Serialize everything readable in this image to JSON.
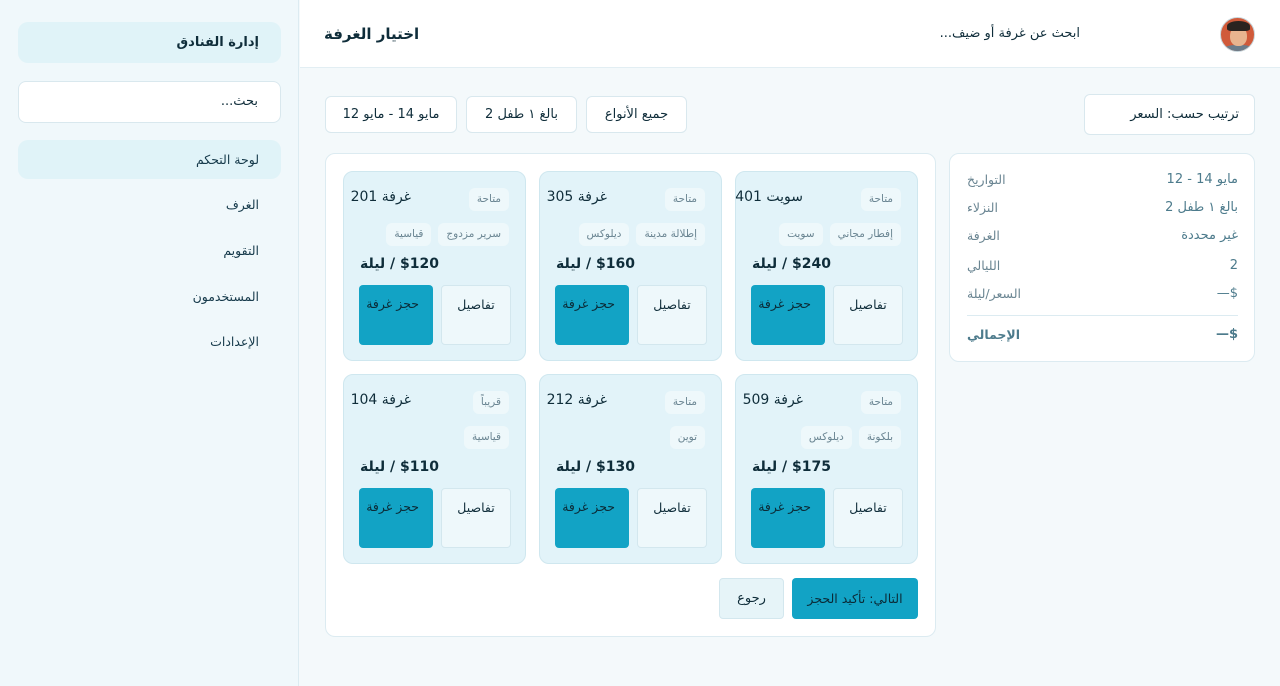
{
  "sidebar": {
    "brand": "إدارة الفنادق",
    "search_placeholder": "بحث...",
    "items": [
      {
        "label": "لوحة التحكم"
      },
      {
        "label": "الغرف"
      },
      {
        "label": "التقويم"
      },
      {
        "label": "المستخدمون"
      },
      {
        "label": "الإعدادات"
      }
    ]
  },
  "header": {
    "title": "اختيار الغرفة",
    "search_placeholder": "ابحث عن غرفة أو ضيف...",
    "avatar_icon": "user-avatar"
  },
  "filters": {
    "dates": "مايو 14 - مايو 12",
    "guests": "بالغ ۱ طفل 2",
    "types": "جميع الأنواع",
    "sort": "ترتيب حسب: السعر"
  },
  "rooms": [
    {
      "name": "سويت 401",
      "status": "متاحة",
      "features": [
        "إفطار مجاني",
        "سويت"
      ],
      "price": "$240 / ليلة",
      "book": "حجز غرفة",
      "details": "تفاصيل"
    },
    {
      "name": "غرفة 305",
      "status": "متاحة",
      "features": [
        "إطلالة مدينة",
        "ديلوكس"
      ],
      "price": "$160 / ليلة",
      "book": "حجز غرفة",
      "details": "تفاصيل"
    },
    {
      "name": "غرفة 201",
      "status": "متاحة",
      "features": [
        "سرير مزدوج",
        "قياسية"
      ],
      "price": "$120 / ليلة",
      "book": "حجز غرفة",
      "details": "تفاصيل"
    },
    {
      "name": "غرفة 509",
      "status": "متاحة",
      "features": [
        "بلكونة",
        "ديلوكس"
      ],
      "price": "$175 / ليلة",
      "book": "حجز غرفة",
      "details": "تفاصيل"
    },
    {
      "name": "غرفة 212",
      "status": "متاحة",
      "features": [
        "توين"
      ],
      "price": "$130 / ليلة",
      "book": "حجز غرفة",
      "details": "تفاصيل"
    },
    {
      "name": "غرفة 104",
      "status": "قريباً",
      "features": [
        "قياسية"
      ],
      "price": "$110 / ليلة",
      "book": "حجز غرفة",
      "details": "تفاصيل"
    }
  ],
  "actions": {
    "back": "رجوع",
    "next": "التالي: تأكيد الحجز"
  },
  "summary": {
    "rows": [
      {
        "label": "التواريخ",
        "value": "مايو 14 - 12"
      },
      {
        "label": "النزلاء",
        "value": "بالغ ۱ طفل 2"
      },
      {
        "label": "الغرفة",
        "value": "غير محددة"
      },
      {
        "label": "الليالي",
        "value": "2"
      },
      {
        "label": "السعر/ليلة",
        "value": "—$"
      }
    ],
    "total_label": "الإجمالي",
    "total_value": "—$"
  },
  "colors": {
    "accent": "#12a3c5",
    "card_bg": "#e2f3f9",
    "sidebar_bg": "#f0f8fb"
  }
}
